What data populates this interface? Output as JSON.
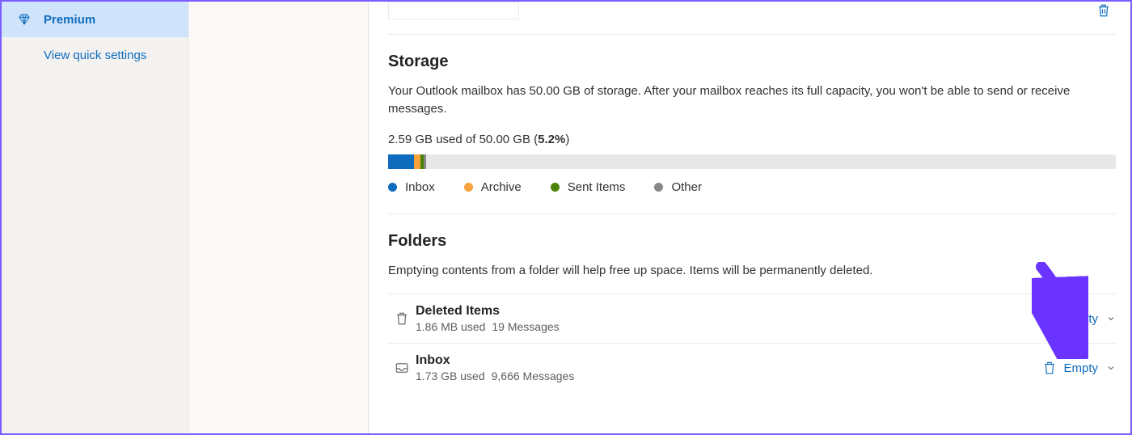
{
  "sidebar": {
    "items": [
      {
        "label": "Premium"
      },
      {
        "label": "View quick settings"
      }
    ]
  },
  "storage": {
    "title": "Storage",
    "description": "Your Outlook mailbox has 50.00 GB of storage. After your mailbox reaches its full capacity, you won't be able to send or receive messages.",
    "used": "2.59 GB",
    "total": "50.00 GB",
    "percent": "5.2%",
    "segments": [
      {
        "label": "Inbox",
        "color": "#0f6cbd",
        "pct": 3.5
      },
      {
        "label": "Archive",
        "color": "#f7a33c",
        "pct": 0.9
      },
      {
        "label": "Sent Items",
        "color": "#498205",
        "pct": 0.5
      },
      {
        "label": "Other",
        "color": "#8a8886",
        "pct": 0.3
      }
    ]
  },
  "folders": {
    "title": "Folders",
    "description": "Emptying contents from a folder will help free up space. Items will be permanently deleted.",
    "empty_label": "Empty",
    "items": [
      {
        "name": "Deleted Items",
        "used": "1.86 MB used",
        "messages": "19 Messages",
        "icon": "trash"
      },
      {
        "name": "Inbox",
        "used": "1.73 GB used",
        "messages": "9,666 Messages",
        "icon": "inbox"
      }
    ]
  }
}
